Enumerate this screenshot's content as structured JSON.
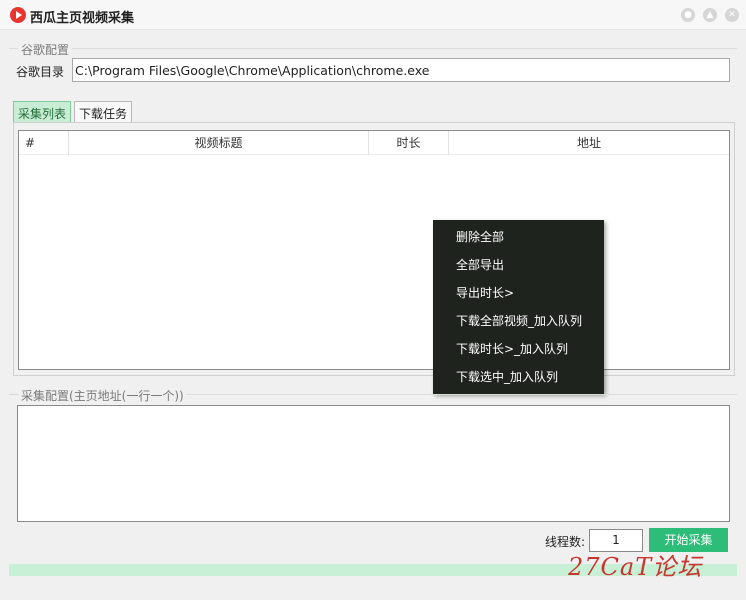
{
  "window": {
    "title": "西瓜主页视频采集"
  },
  "chrome_config": {
    "group_label": "谷歌配置",
    "dir_label": "谷歌目录",
    "path": "C:\\Program Files\\Google\\Chrome\\Application\\chrome.exe"
  },
  "tabs": [
    {
      "label": "采集列表",
      "active": true
    },
    {
      "label": "下载任务",
      "active": false
    }
  ],
  "table": {
    "columns": [
      "#",
      "视频标题",
      "时长",
      "地址"
    ]
  },
  "context_menu": {
    "items": [
      "删除全部",
      "全部导出",
      "导出时长>",
      "下载全部视频_加入队列",
      "下载时长>_加入队列",
      "下载选中_加入队列"
    ]
  },
  "collect_config": {
    "group_label": "采集配置(主页地址(一行一个))",
    "urls": ""
  },
  "controls": {
    "thread_label": "线程数:",
    "thread_value": "1",
    "start_label": "开始采集"
  },
  "progress": {
    "value": 1.0
  },
  "watermark": "27CaT论坛",
  "colors": {
    "accent": "#2dbd78",
    "menu_bg": "#1f231e",
    "tab_active": "#c8ecd4"
  }
}
